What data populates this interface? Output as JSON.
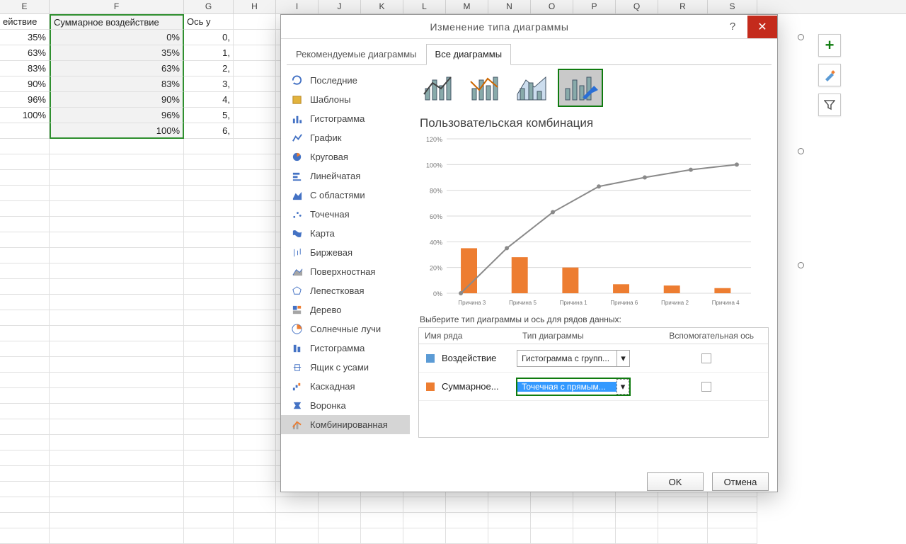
{
  "columns": [
    "E",
    "F",
    "G",
    "H",
    "I",
    "J",
    "K",
    "L",
    "M",
    "N",
    "O",
    "P",
    "Q",
    "R",
    "S"
  ],
  "grid": {
    "header": {
      "E": "ействие",
      "F": "Суммарное воздействие",
      "G": "Ось у"
    },
    "rows": [
      {
        "E": "35%",
        "F": "0%",
        "G": "0,"
      },
      {
        "E": "63%",
        "F": "35%",
        "G": "1,"
      },
      {
        "E": "83%",
        "F": "63%",
        "G": "2,"
      },
      {
        "E": "90%",
        "F": "83%",
        "G": "3,"
      },
      {
        "E": "96%",
        "F": "90%",
        "G": "4,"
      },
      {
        "E": "100%",
        "F": "96%",
        "G": "5,"
      },
      {
        "E": "",
        "F": "100%",
        "G": "6,"
      }
    ]
  },
  "dialog": {
    "title": "Изменение типа диаграммы",
    "tabs": {
      "rec": "Рекомендуемые диаграммы",
      "all": "Все диаграммы"
    },
    "categories": [
      "Последние",
      "Шаблоны",
      "Гистограмма",
      "График",
      "Круговая",
      "Линейчатая",
      "С областями",
      "Точечная",
      "Карта",
      "Биржевая",
      "Поверхностная",
      "Лепестковая",
      "Дерево",
      "Солнечные лучи",
      "Гистограмма",
      "Ящик с усами",
      "Каскадная",
      "Воронка",
      "Комбинированная"
    ],
    "selected_category": "Комбинированная",
    "preview_title": "Пользовательская комбинация",
    "series_prompt": "Выберите тип диаграммы и ось для рядов данных:",
    "series_table": {
      "cols": {
        "name": "Имя ряда",
        "type": "Тип диаграммы",
        "aux": "Вспомогательная ось"
      },
      "rows": [
        {
          "name": "Воздействие",
          "type": "Гистограмма с групп...",
          "color": "blue",
          "aux": false,
          "sel": false
        },
        {
          "name": "Суммарное...",
          "type": "Точечная с прямым...",
          "color": "orange",
          "aux": false,
          "sel": true
        }
      ]
    },
    "buttons": {
      "ok": "OK",
      "cancel": "Отмена"
    }
  },
  "chart_data": {
    "type": "bar",
    "title": "Пользовательская комбинация",
    "ylabel": "",
    "ylim": [
      0,
      120
    ],
    "yticks": [
      "0%",
      "20%",
      "40%",
      "60%",
      "80%",
      "100%",
      "120%"
    ],
    "categories": [
      "Причина 3",
      "Причина 5",
      "Причина 1",
      "Причина 6",
      "Причина 2",
      "Причина 4"
    ],
    "series": [
      {
        "name": "Воздействие",
        "type": "bar",
        "color": "#ed7d31",
        "values": [
          35,
          28,
          20,
          7,
          6,
          4
        ]
      },
      {
        "name": "Суммарное воздействие",
        "type": "line",
        "color": "#8a8a8a",
        "values": [
          0,
          35,
          63,
          83,
          90,
          96,
          100
        ]
      }
    ]
  },
  "mini_tools": {
    "add": "+",
    "brush": "",
    "filter": ""
  }
}
